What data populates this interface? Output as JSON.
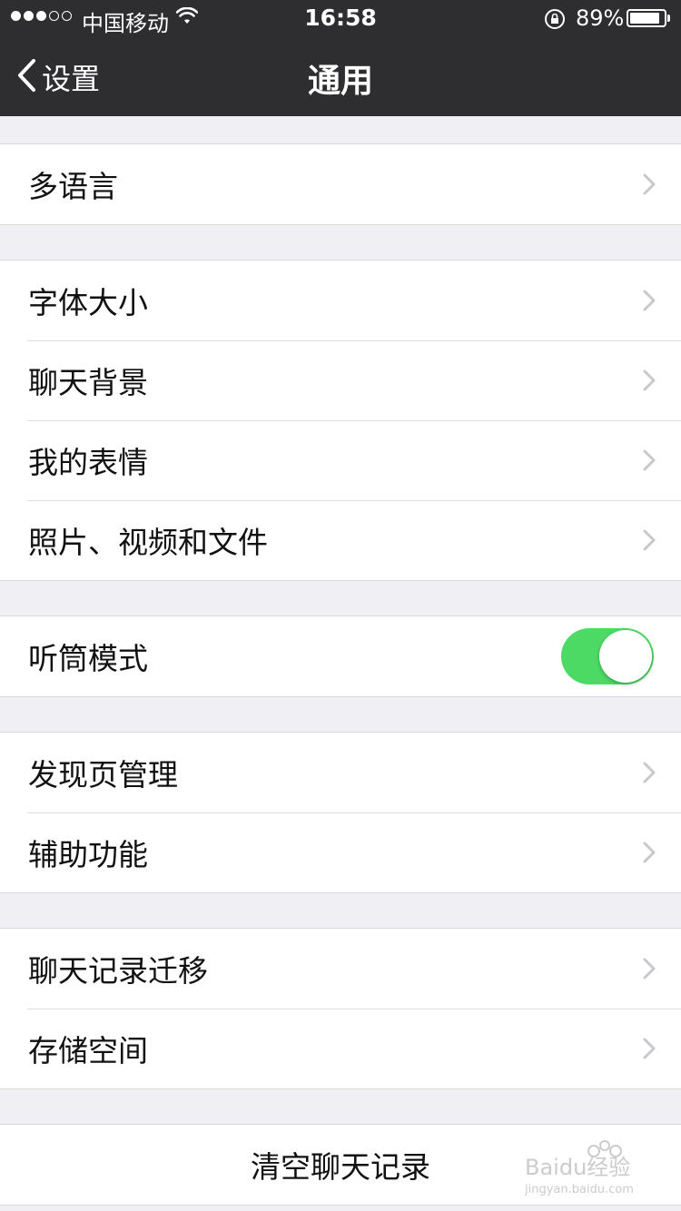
{
  "status_bar": {
    "carrier": "中国移动",
    "time": "16:58",
    "battery": "89%",
    "battery_level": 0.89,
    "signal_bars_full": 3,
    "signal_bars_total": 5
  },
  "nav": {
    "back_label": "设置",
    "title": "通用"
  },
  "groups": [
    {
      "items": [
        {
          "label": "多语言"
        }
      ]
    },
    {
      "items": [
        {
          "label": "字体大小"
        },
        {
          "label": "聊天背景"
        },
        {
          "label": "我的表情"
        },
        {
          "label": "照片、视频和文件"
        }
      ]
    },
    {
      "items": [
        {
          "label": "听筒模式",
          "toggle_on": true
        }
      ]
    },
    {
      "items": [
        {
          "label": "发现页管理"
        },
        {
          "label": "辅助功能"
        }
      ]
    },
    {
      "items": [
        {
          "label": "聊天记录迁移"
        },
        {
          "label": "存储空间"
        }
      ]
    },
    {
      "items": [
        {
          "label": "清空聊天记录"
        }
      ]
    }
  ],
  "watermark": {
    "brand": "Baidu经验",
    "url": "jingyan.baidu.com"
  },
  "colors": {
    "nav_background": "#2e2e31",
    "page_background": "#efeff4",
    "toggle_on": "#4cd964"
  }
}
